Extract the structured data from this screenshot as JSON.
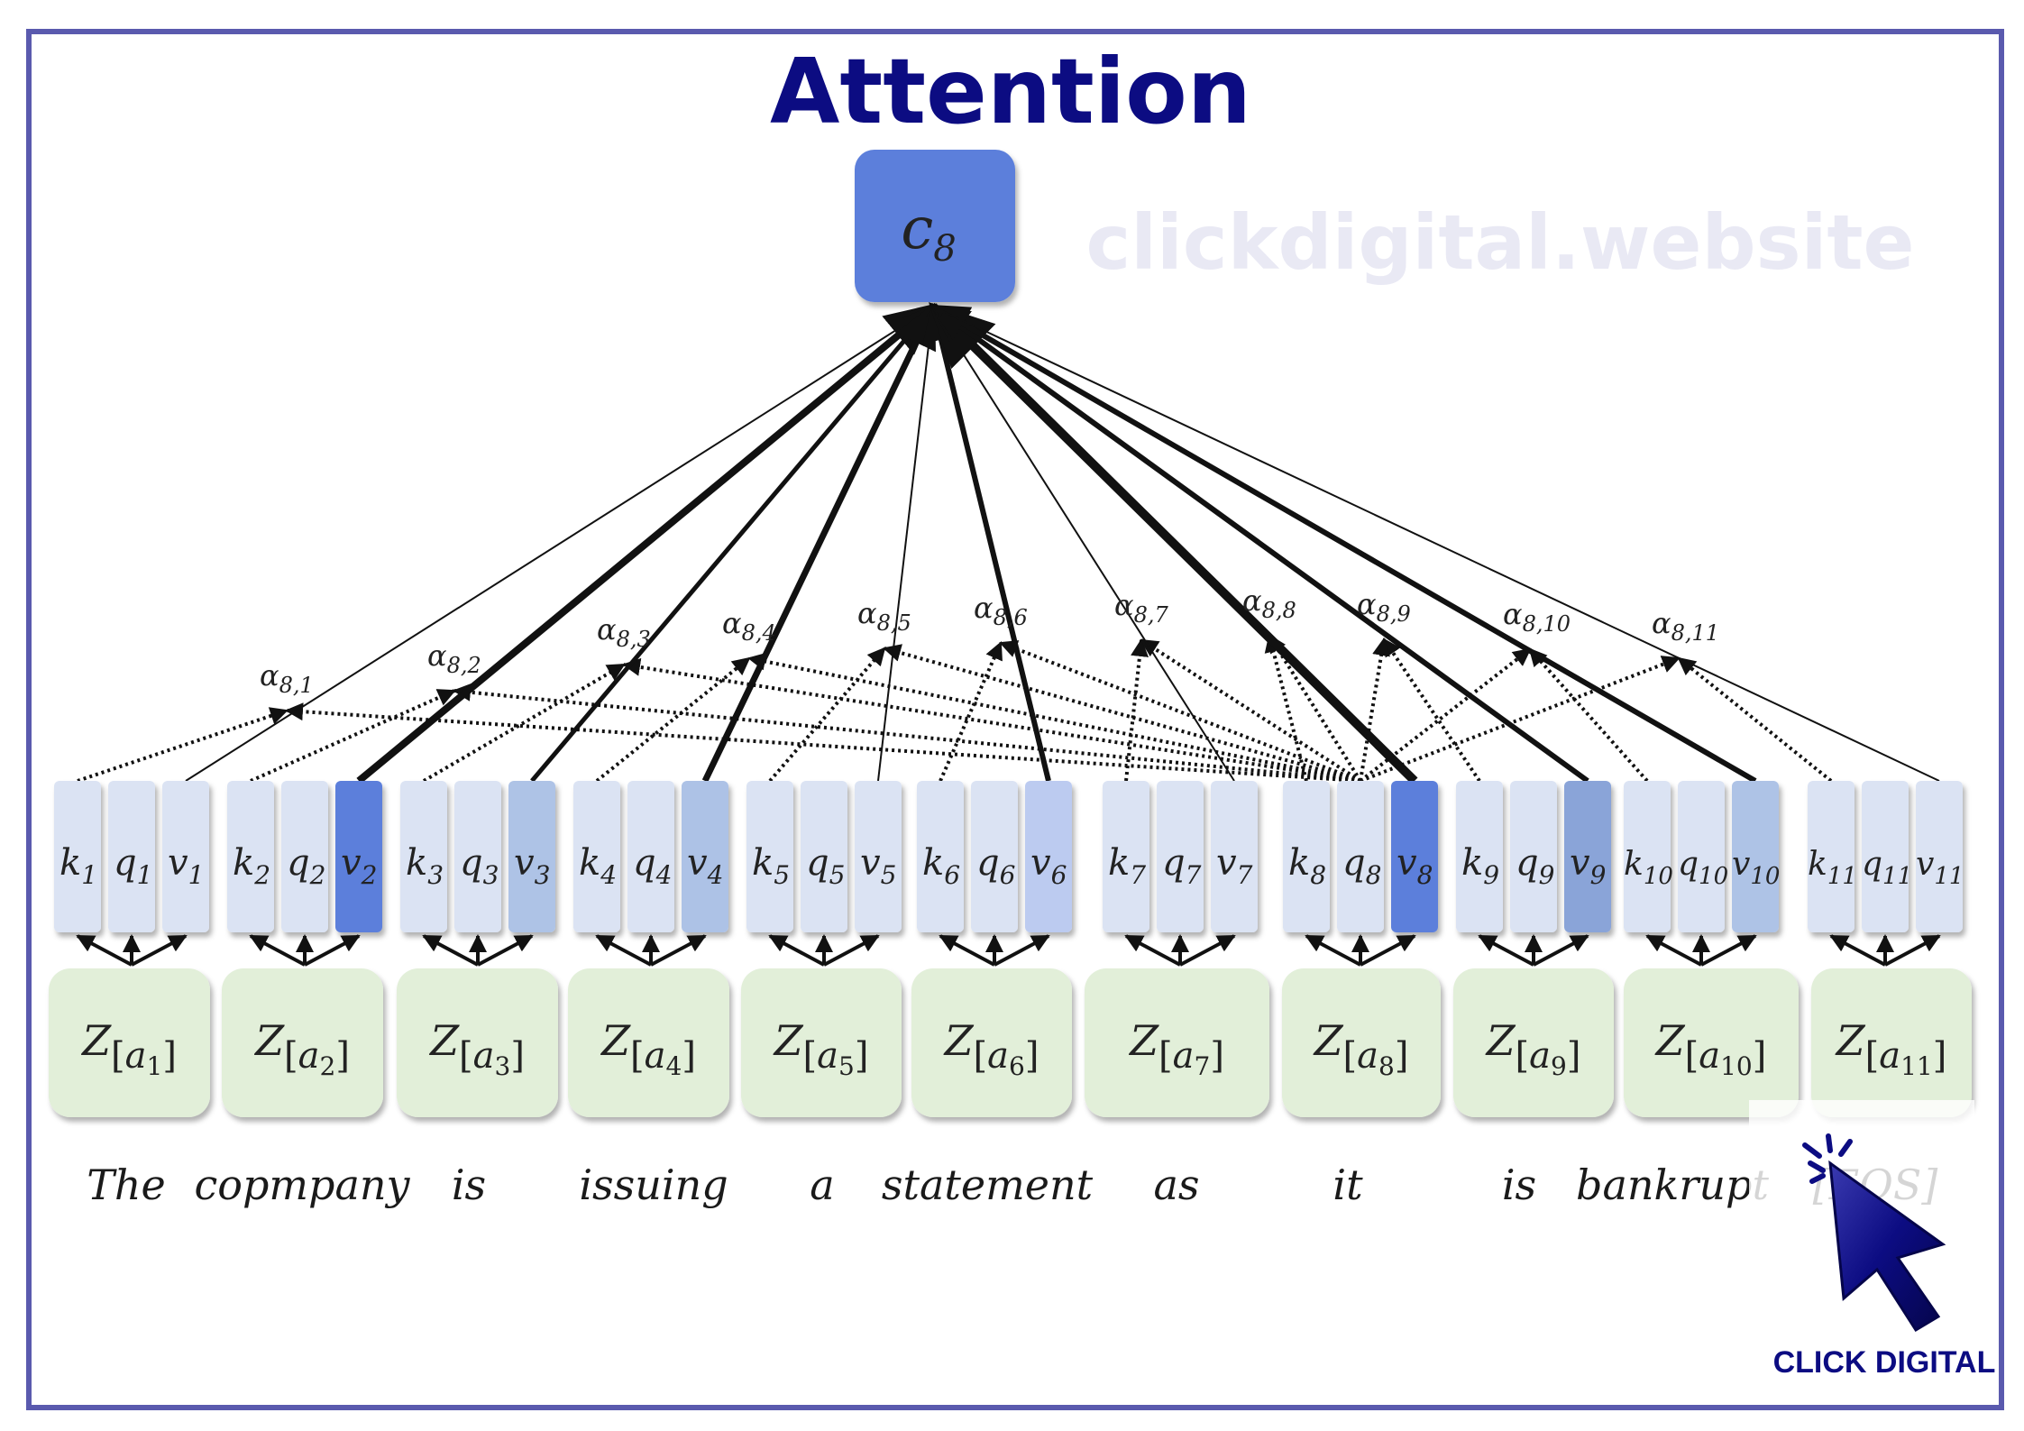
{
  "title": "Attention",
  "watermark": "clickdigital.website",
  "context_vector": {
    "symbol": "c",
    "index": "8",
    "color": "#5b7fdb"
  },
  "symbols": {
    "key": "k",
    "query": "q",
    "value": "v",
    "embedding": "Z",
    "token": "a",
    "alpha": "α"
  },
  "colors": {
    "kqv_default": "#dbe3f3",
    "embedding_fill": "#e2efd9",
    "frame": "#5a5aae",
    "title": "#0c0c82"
  },
  "tokens": [
    {
      "index": "1",
      "word": "The",
      "v_color": "#dbe3f3",
      "alpha": "8,1"
    },
    {
      "index": "2",
      "word": "copmpany",
      "v_color": "#5b7fdb",
      "alpha": "8,2"
    },
    {
      "index": "3",
      "word": "is",
      "v_color": "#aec3e6",
      "alpha": "8,3"
    },
    {
      "index": "4",
      "word": "issuing",
      "v_color": "#adc2e6",
      "alpha": "8,4"
    },
    {
      "index": "5",
      "word": "a",
      "v_color": "#dbe3f3",
      "alpha": "8,5"
    },
    {
      "index": "6",
      "word": "statement",
      "v_color": "#bccbf0",
      "alpha": "8,6"
    },
    {
      "index": "7",
      "word": "as",
      "v_color": "#dbe3f3",
      "alpha": "8,7"
    },
    {
      "index": "8",
      "word": "it",
      "v_color": "#5b7fdb",
      "alpha": "8,8"
    },
    {
      "index": "9",
      "word": "is",
      "v_color": "#8aa4d8",
      "alpha": "8,9"
    },
    {
      "index": "10",
      "word": "bankrupt",
      "v_color": "#aec3e6",
      "alpha": "8,10"
    },
    {
      "index": "11",
      "word": "[EOS]",
      "v_color": "#dbe3f3",
      "alpha": "8,11"
    }
  ],
  "logo": {
    "text": "CLICK DIGITAL",
    "icon": "cursor-click-icon"
  }
}
